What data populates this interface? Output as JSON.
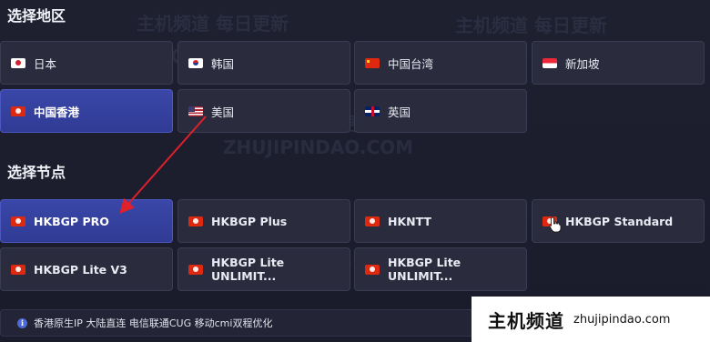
{
  "sections": {
    "region_title": "选择地区",
    "node_title": "选择节点"
  },
  "regions": [
    {
      "label": "日本",
      "flag": "jp-flag-icon",
      "selected": false
    },
    {
      "label": "韩国",
      "flag": "kr-flag-icon",
      "selected": false
    },
    {
      "label": "中国台湾",
      "flag": "cn-flag-icon",
      "selected": false
    },
    {
      "label": "新加坡",
      "flag": "sg-flag-icon",
      "selected": false
    },
    {
      "label": "中国香港",
      "flag": "hk-flag-icon",
      "selected": true
    },
    {
      "label": "美国",
      "flag": "us-flag-icon",
      "selected": false
    },
    {
      "label": "英国",
      "flag": "gb-flag-icon",
      "selected": false
    }
  ],
  "nodes": [
    {
      "label": "HKBGP PRO",
      "flag": "hk-flag-icon",
      "selected": true
    },
    {
      "label": "HKBGP Plus",
      "flag": "hk-flag-icon",
      "selected": false
    },
    {
      "label": "HKNTT",
      "flag": "hk-flag-icon",
      "selected": false
    },
    {
      "label": "HKBGP Standard",
      "flag": "hk-flag-icon",
      "selected": false
    },
    {
      "label": "HKBGP Lite V3",
      "flag": "hk-flag-icon",
      "selected": false
    },
    {
      "label": "HKBGP Lite UNLIMIT...",
      "flag": "hk-flag-icon",
      "selected": false
    },
    {
      "label": "HKBGP Lite UNLIMIT...",
      "flag": "hk-flag-icon",
      "selected": false
    }
  ],
  "info": {
    "icon": "info-icon",
    "text": "香港原生IP 大陆直连 电信联通CUG 移动cmi双程优化"
  },
  "watermark": {
    "cn": "主机频道",
    "url": "zhujipindao.com",
    "ghost_cn": "主机频道 每日更新",
    "ghost_en": "ZHUJIPINDAO.COM"
  },
  "colors": {
    "background": "#1b1d2e",
    "card": "#2a2c3d",
    "selected": "#3441a0",
    "annotation_arrow": "#e0202a"
  }
}
